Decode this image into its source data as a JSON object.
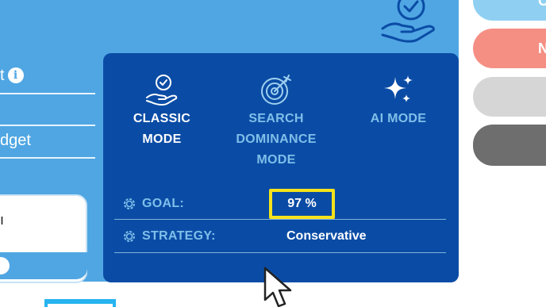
{
  "background_card": {
    "field_label_1": "t",
    "info_icon": "info-icon",
    "field_label_2": "dget",
    "header_icon": "hand-check-icon"
  },
  "side_buttons": {
    "button_1": "C",
    "button_2": "N"
  },
  "mode_panel": {
    "modes": [
      {
        "label_line1": "CLASSIC",
        "label_line2": "MODE",
        "icon": "hand-check-icon",
        "active": true
      },
      {
        "label_line1": "SEARCH",
        "label_line2": "DOMINANCE",
        "label_line3": "MODE",
        "icon": "target-icon",
        "active": false
      },
      {
        "label_line1": "AI MODE",
        "icon": "sparkles-icon",
        "active": false
      }
    ],
    "goal": {
      "label": "GOAL:",
      "value": "97 %"
    },
    "strategy": {
      "label": "STRATEGY:",
      "value": "Conservative"
    }
  },
  "colors": {
    "panel_bg": "#0a4ca5",
    "card_bg": "#4fa6e3",
    "accent_text": "#7fbfea",
    "highlight": "#f5e21b"
  }
}
